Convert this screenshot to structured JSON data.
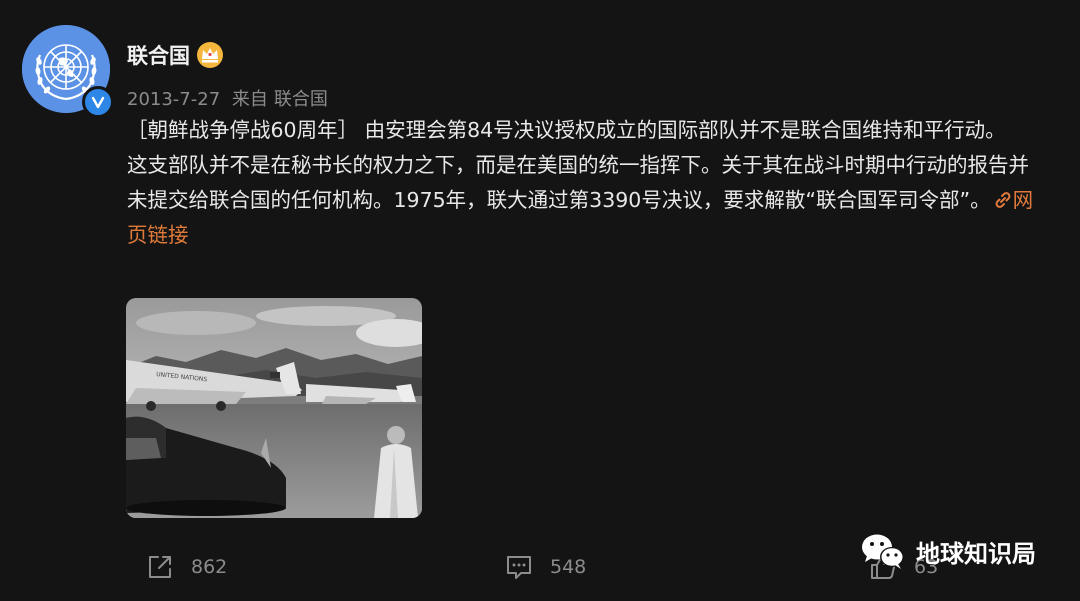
{
  "post": {
    "author": "联合国",
    "date": "2013-7-27",
    "source_prefix": "来自",
    "source": "联合国",
    "text_lines": [
      "［朝鲜战争停战60周年］ 由安理会第84号决议授权成立的国际部队并不是联合国维持和平行动。",
      "这支部队并不是在秘书长的权力之下，而是在美国的统一指挥下。关于其在战斗时期中行动的报告并",
      "未提交给联合国的任何机构。1975年，联大通过第3390号决议，要求解散“联合国军司令部”。"
    ],
    "link_label_part1": "网",
    "link_label_part2": "页链接",
    "plane_label": "UNITED NATIONS"
  },
  "actions": {
    "share_count": "862",
    "comment_count": "548",
    "like_count": "63"
  },
  "watermark": {
    "text": "地球知识局"
  },
  "icons": {
    "verified": "verified-badge-icon",
    "crown": "crown-icon",
    "link": "link-icon",
    "share": "share-icon",
    "comment": "comment-icon",
    "like": "thumbs-up-icon",
    "wechat": "wechat-icon"
  },
  "colors": {
    "background": "#141414",
    "link": "#e07a3a",
    "verified": "#2e86e6",
    "avatar": "#5b92e5"
  }
}
